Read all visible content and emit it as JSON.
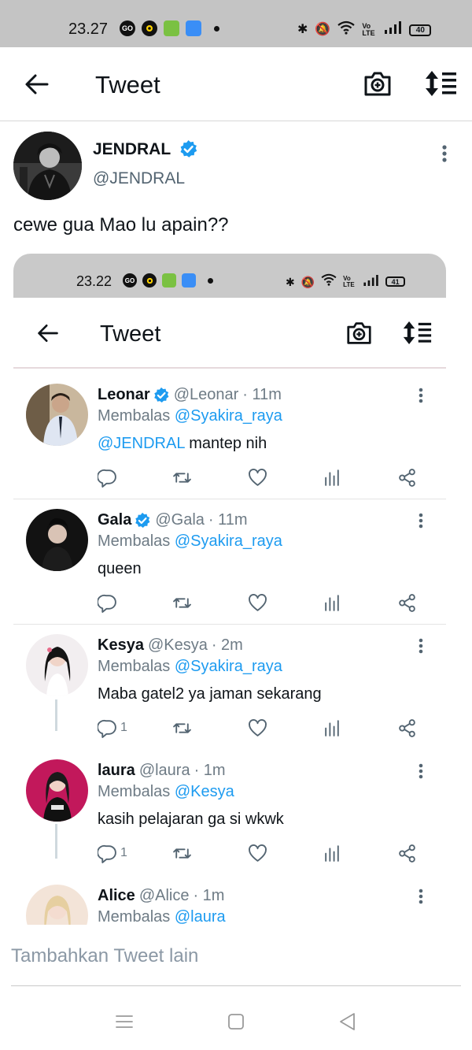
{
  "status_bar": {
    "time": "23.27",
    "battery": "40",
    "network": "Vo LTE",
    "left_app_label": "GO"
  },
  "header": {
    "title": "Tweet"
  },
  "tweet": {
    "author_name": "JENDRAL",
    "author_handle": "@JENDRAL",
    "text": "cewe gua Mao lu apain??"
  },
  "embedded": {
    "status_bar": {
      "time": "23.22",
      "battery": "41",
      "network": "Vo LTE",
      "left_app_label": "GO"
    },
    "header": {
      "title": "Tweet"
    },
    "replies": [
      {
        "name": "Leonar",
        "verified": true,
        "handle": "@Leonar",
        "time": "· 11m",
        "replying_label": "Membalas",
        "replying_to": "@Syakira_raya",
        "text_mention": "@JENDRAL",
        "text": " mantep nih",
        "reply_count": ""
      },
      {
        "name": "Gala",
        "verified": true,
        "handle": "@Gala",
        "time": "· 11m",
        "replying_label": "Membalas",
        "replying_to": "@Syakira_raya",
        "text_mention": "",
        "text": "queen",
        "reply_count": ""
      },
      {
        "name": "Kesya",
        "verified": false,
        "handle": "@Kesya",
        "time": "· 2m",
        "replying_label": "Membalas",
        "replying_to": "@Syakira_raya",
        "text_mention": "",
        "text": "Maba gatel2 ya jaman sekarang",
        "reply_count": "1"
      },
      {
        "name": "laura",
        "verified": false,
        "handle": "@laura",
        "time": "· 1m",
        "replying_label": "Membalas",
        "replying_to": "@Kesya",
        "text_mention": "",
        "text": "kasih pelajaran ga si wkwk",
        "reply_count": "1"
      },
      {
        "name": "Alice",
        "verified": false,
        "handle": "@Alice",
        "time": "· 1m",
        "replying_label": "Membalas",
        "replying_to": "@laura",
        "text_mention": "",
        "text": "",
        "reply_count": ""
      }
    ]
  },
  "compose": {
    "placeholder": "Tambahkan Tweet lain"
  },
  "icons": {
    "back": "arrow-left-icon",
    "camera": "camera-plus-icon",
    "sort": "sort-icon",
    "verified": "verified-badge-icon",
    "more": "more-vertical-icon",
    "reply": "reply-icon",
    "retweet": "retweet-icon",
    "like": "heart-icon",
    "views": "analytics-icon",
    "share": "share-icon",
    "nav_menu": "menu-icon",
    "nav_home": "home-square-icon",
    "nav_back": "back-triangle-icon"
  },
  "colors": {
    "accent": "#1d9bf0",
    "status_bar": "#c4c4c4",
    "muted": "#536471",
    "text": "#0f1419"
  }
}
